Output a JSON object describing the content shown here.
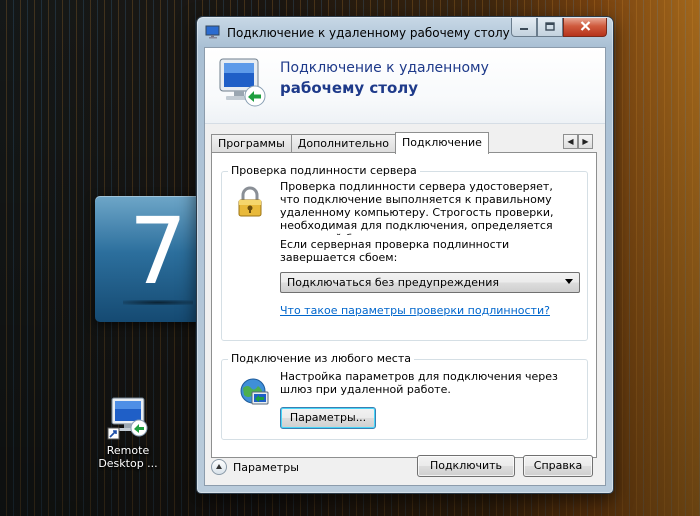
{
  "desktop": {
    "badge_text": "7",
    "icons": [
      {
        "label": "Remote Desktop ...",
        "icon": "remote-desktop-icon"
      }
    ]
  },
  "window": {
    "title": "Подключение к удаленному рабочему столу",
    "banner": {
      "line1": "Подключение к удаленному",
      "line2": "рабочему столу"
    },
    "tabs": [
      {
        "label": "Программы",
        "active": false
      },
      {
        "label": "Дополнительно",
        "active": false
      },
      {
        "label": "Подключение",
        "active": true
      }
    ],
    "server_auth": {
      "legend": "Проверка подлинности сервера",
      "description": "Проверка подлинности сервера удостоверяет, что подключение выполняется к правильному удаленному компьютеру. Строгость проверки, необходимая для подключения, определяется политикой безопасности системы.",
      "question": "Если серверная проверка подлинности завершается сбоем:",
      "dropdown_value": "Подключаться без предупреждения",
      "link": "Что такое параметры проверки подлинности?"
    },
    "anywhere": {
      "legend": "Подключение из любого места",
      "description": "Настройка параметров для подключения через шлюз при удаленной работе.",
      "button": "Параметры..."
    },
    "footer": {
      "options_label": "Параметры",
      "connect_button": "Подключить",
      "help_button": "Справка"
    }
  },
  "colors": {
    "banner_text": "#1e3a8a",
    "link": "#0066cc",
    "close_button": "#c44a2e",
    "badge": "#2c6f9d"
  }
}
